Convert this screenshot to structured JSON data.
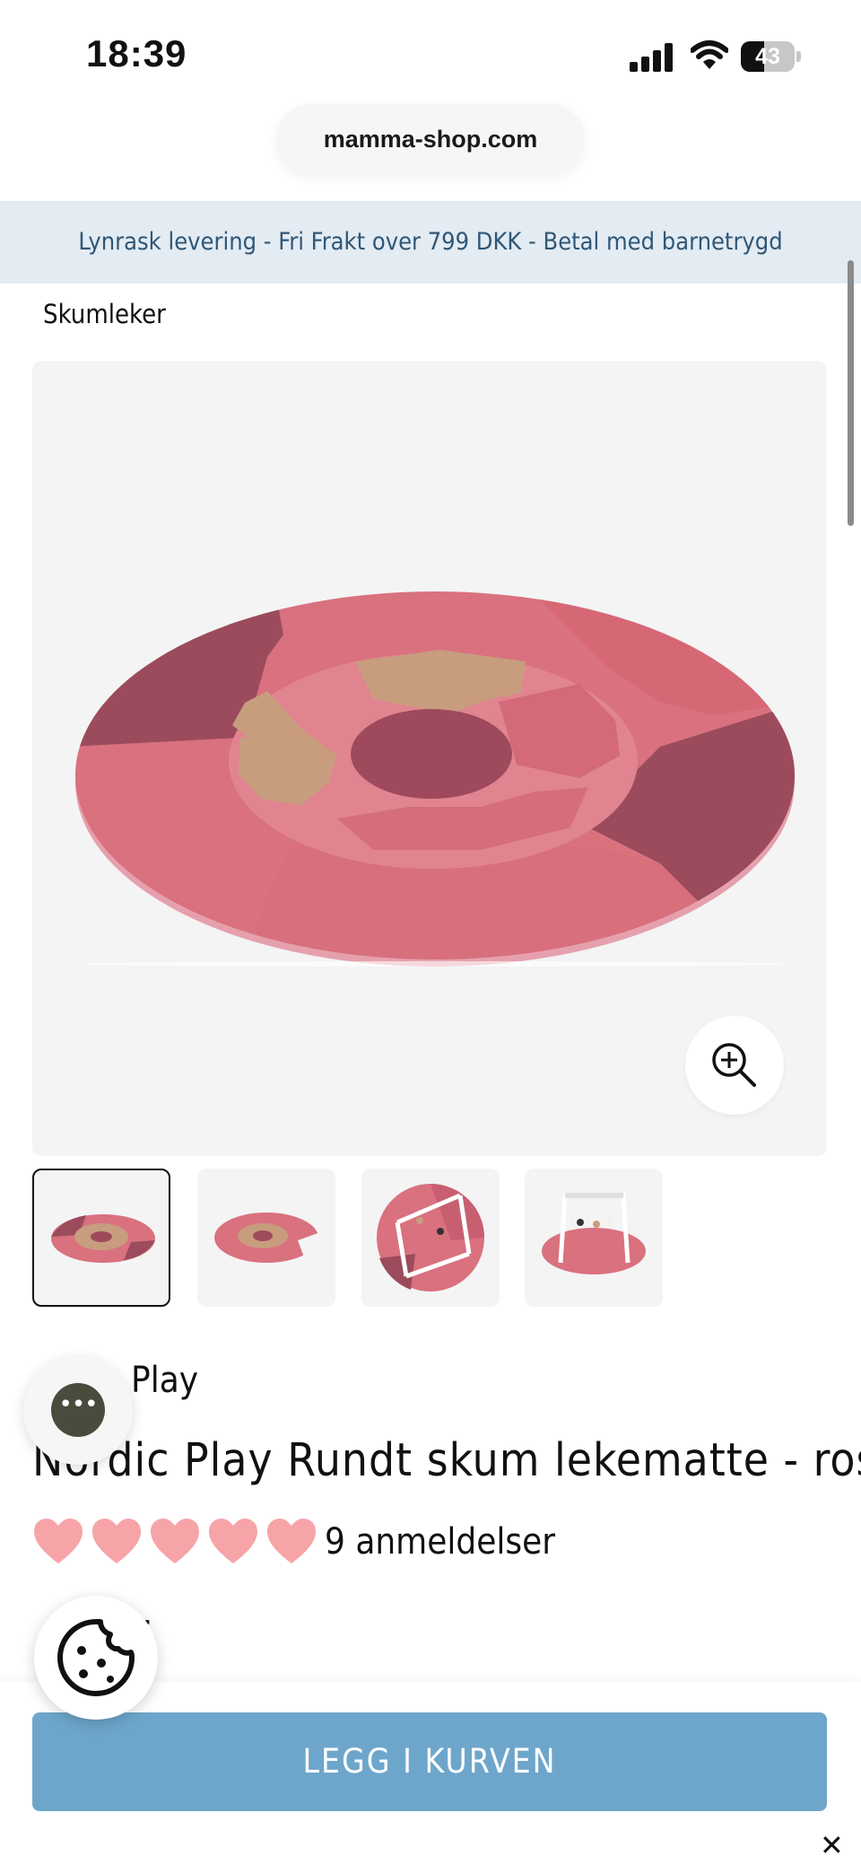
{
  "status_bar": {
    "time": "18:39",
    "battery_level": "43"
  },
  "browser": {
    "url": "mamma-shop.com"
  },
  "announcement": "Lynrask levering - Fri Frakt over 799 DKK - Betal med barnetrygd",
  "breadcrumb": "Skumleker",
  "product": {
    "brand": "Play",
    "title": "Nordic Play Rundt skum lekematte - rosa",
    "rating": 5,
    "rating_max": 5,
    "review_count_label": "9 anmeldelser",
    "price": "kr",
    "thumbnails_count": 4,
    "selected_thumbnail": 0
  },
  "actions": {
    "add_to_cart": "LEGG I KURVEN"
  },
  "close_glyph": "✕",
  "colors": {
    "announcement_bg": "#e3ebf3",
    "announcement_text": "#2f5777",
    "button_bg": "#6ea6cb",
    "heart": "#f6a4a8",
    "mat_pink": "#d9717f",
    "mat_dark": "#9b4b5c",
    "mat_tan": "#c79d7e"
  },
  "icons": {
    "zoom": "zoom-in-icon",
    "chat": "chat-bubble-icon",
    "cookie": "cookie-icon",
    "close": "close-icon"
  }
}
